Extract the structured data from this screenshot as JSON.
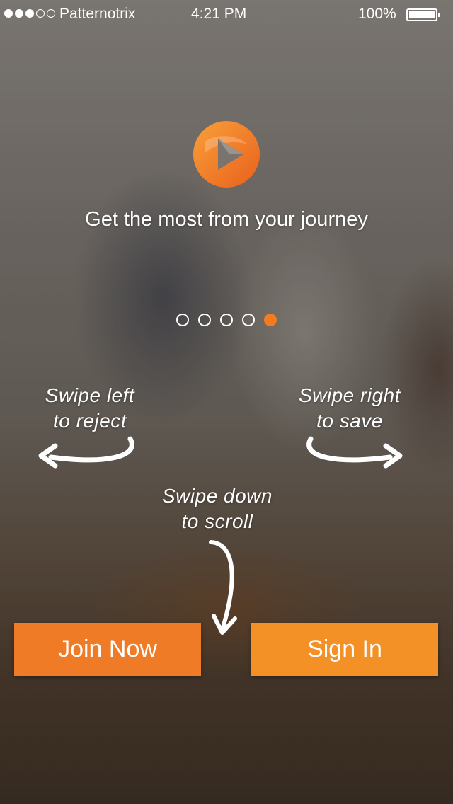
{
  "status_bar": {
    "carrier": "Patternotrix",
    "time": "4:21 PM",
    "battery_percent": "100%",
    "signal_bars_filled": 3,
    "signal_bars_total": 5
  },
  "onboarding": {
    "headline": "Get the most from your journey",
    "page_indicator": {
      "total": 5,
      "active_index": 4
    },
    "hints": {
      "left": "Swipe left to reject",
      "right": "Swipe right to save",
      "down": "Swipe down to scroll"
    }
  },
  "actions": {
    "join_label": "Join Now",
    "sign_in_label": "Sign In"
  },
  "colors": {
    "accent": "#f47b20",
    "join_button": "#f07b27",
    "sign_in_button": "#f39127"
  },
  "icons": {
    "logo": "play-logo-icon",
    "swipe_left": "curved-arrow-left-icon",
    "swipe_right": "curved-arrow-right-icon",
    "swipe_down": "curved-arrow-down-icon"
  }
}
